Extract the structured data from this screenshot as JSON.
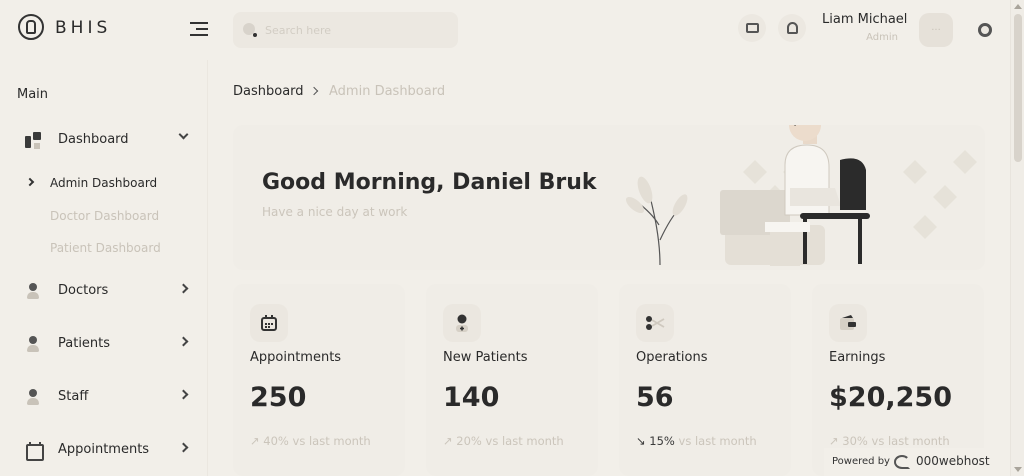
{
  "header": {
    "brand": "BHIS",
    "search_placeholder": "Search here",
    "user_name": "Liam Michael",
    "user_role": "Admin",
    "avatar_text": "···"
  },
  "sidebar": {
    "section": "Main",
    "items": [
      {
        "label": "Dashboard",
        "icon": "dashboard-icon"
      },
      {
        "label": "Doctors",
        "icon": "doctor-icon"
      },
      {
        "label": "Patients",
        "icon": "patient-icon"
      },
      {
        "label": "Staff",
        "icon": "staff-icon"
      },
      {
        "label": "Appointments",
        "icon": "calendar-icon"
      }
    ],
    "sub_items": [
      "Admin Dashboard",
      "Doctor Dashboard",
      "Patient Dashboard"
    ]
  },
  "breadcrumb": {
    "home": "Dashboard",
    "current": "Admin Dashboard"
  },
  "welcome": {
    "greeting": "Good Morning, Daniel Bruk",
    "subtitle": "Have a nice day at work"
  },
  "stats": [
    {
      "label": "Appointments",
      "value": "250",
      "change": "40%",
      "suffix": "vs last month",
      "direction": "up"
    },
    {
      "label": "New Patients",
      "value": "140",
      "change": "20%",
      "suffix": "vs last month",
      "direction": "up"
    },
    {
      "label": "Operations",
      "value": "56",
      "change": "15%",
      "suffix": "vs last month",
      "direction": "down"
    },
    {
      "label": "Earnings",
      "value": "$20,250",
      "change": "30%",
      "suffix": "vs last month",
      "direction": "up"
    }
  ],
  "footer": {
    "powered_by": "Powered by",
    "host": "000webhost"
  },
  "colors": {
    "background": "#f2efe9",
    "text": "#2a2a2a",
    "muted": "#c9c3b9"
  }
}
